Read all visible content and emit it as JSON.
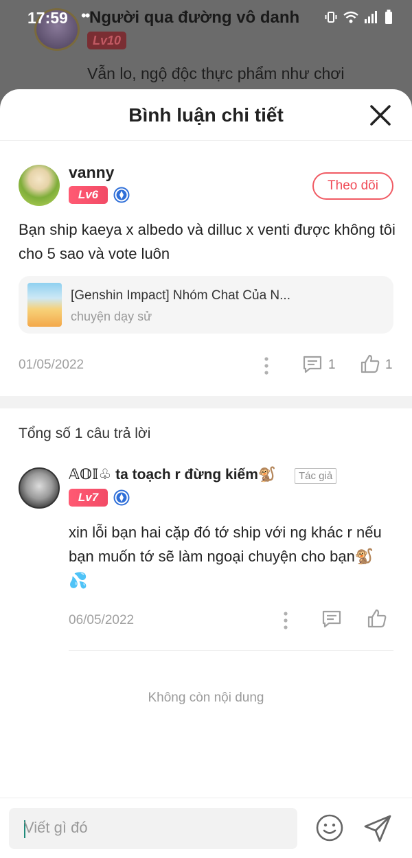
{
  "status_bar": {
    "time": "17:59",
    "dots": "••"
  },
  "background": {
    "username": "Người qua đường vô danh",
    "level": "Lv10",
    "comment_excerpt": "Vẫn lo, ngộ độc thực phẩm như chơi"
  },
  "sheet": {
    "title": "Bình luận chi tiết"
  },
  "main_comment": {
    "username": "vanny",
    "level": "Lv6",
    "follow_label": "Theo dõi",
    "text": "Bạn ship kaeya x albedo và dilluc x venti được không tôi cho 5 sao và vote luôn",
    "link_title": "[Genshin Impact] Nhóm Chat Của N...",
    "link_subtitle": "chuyện dạy sử",
    "date": "01/05/2022",
    "reply_count": "1",
    "like_count": "1"
  },
  "replies_section": {
    "total_label": "Tổng số 1 câu trả lời"
  },
  "reply": {
    "username": "𝔸𝕆𝕀♧ ta toạch r đừng kiếm🐒",
    "author_tag": "Tác giả",
    "level": "Lv7",
    "text": "xin lỗi bạn hai cặp đó tớ ship với ng khác r nếu bạn muốn tớ sẽ làm ngoại chuyện cho bạn🐒💦",
    "date": "06/05/2022"
  },
  "end_label": "Không còn nội dung",
  "input": {
    "placeholder": "Viết gì đó"
  },
  "colors": {
    "accent": "#f04a56",
    "level_badge": "#f24b66",
    "verified": "#2f6fd8"
  }
}
